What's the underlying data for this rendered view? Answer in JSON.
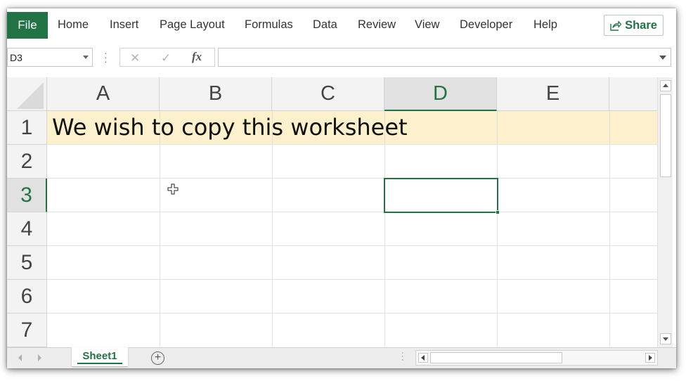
{
  "ribbon": {
    "file_label": "File",
    "tabs": [
      "Home",
      "Insert",
      "Page Layout",
      "Formulas",
      "Data",
      "Review",
      "View",
      "Developer",
      "Help"
    ],
    "share_label": "Share"
  },
  "formula_bar": {
    "name_box": "D3",
    "fx_label": "fx",
    "formula": ""
  },
  "grid": {
    "columns": [
      "A",
      "B",
      "C",
      "D",
      "E"
    ],
    "rows": [
      "1",
      "2",
      "3",
      "4",
      "5",
      "6",
      "7"
    ],
    "active_cell": "D3",
    "a1_value": "We wish to copy this worksheet",
    "row1_fill_color": "#fdf0cd",
    "accent_color": "#217346"
  },
  "sheets": {
    "tabs": [
      "Sheet1"
    ],
    "active": "Sheet1",
    "add_label": "+"
  }
}
